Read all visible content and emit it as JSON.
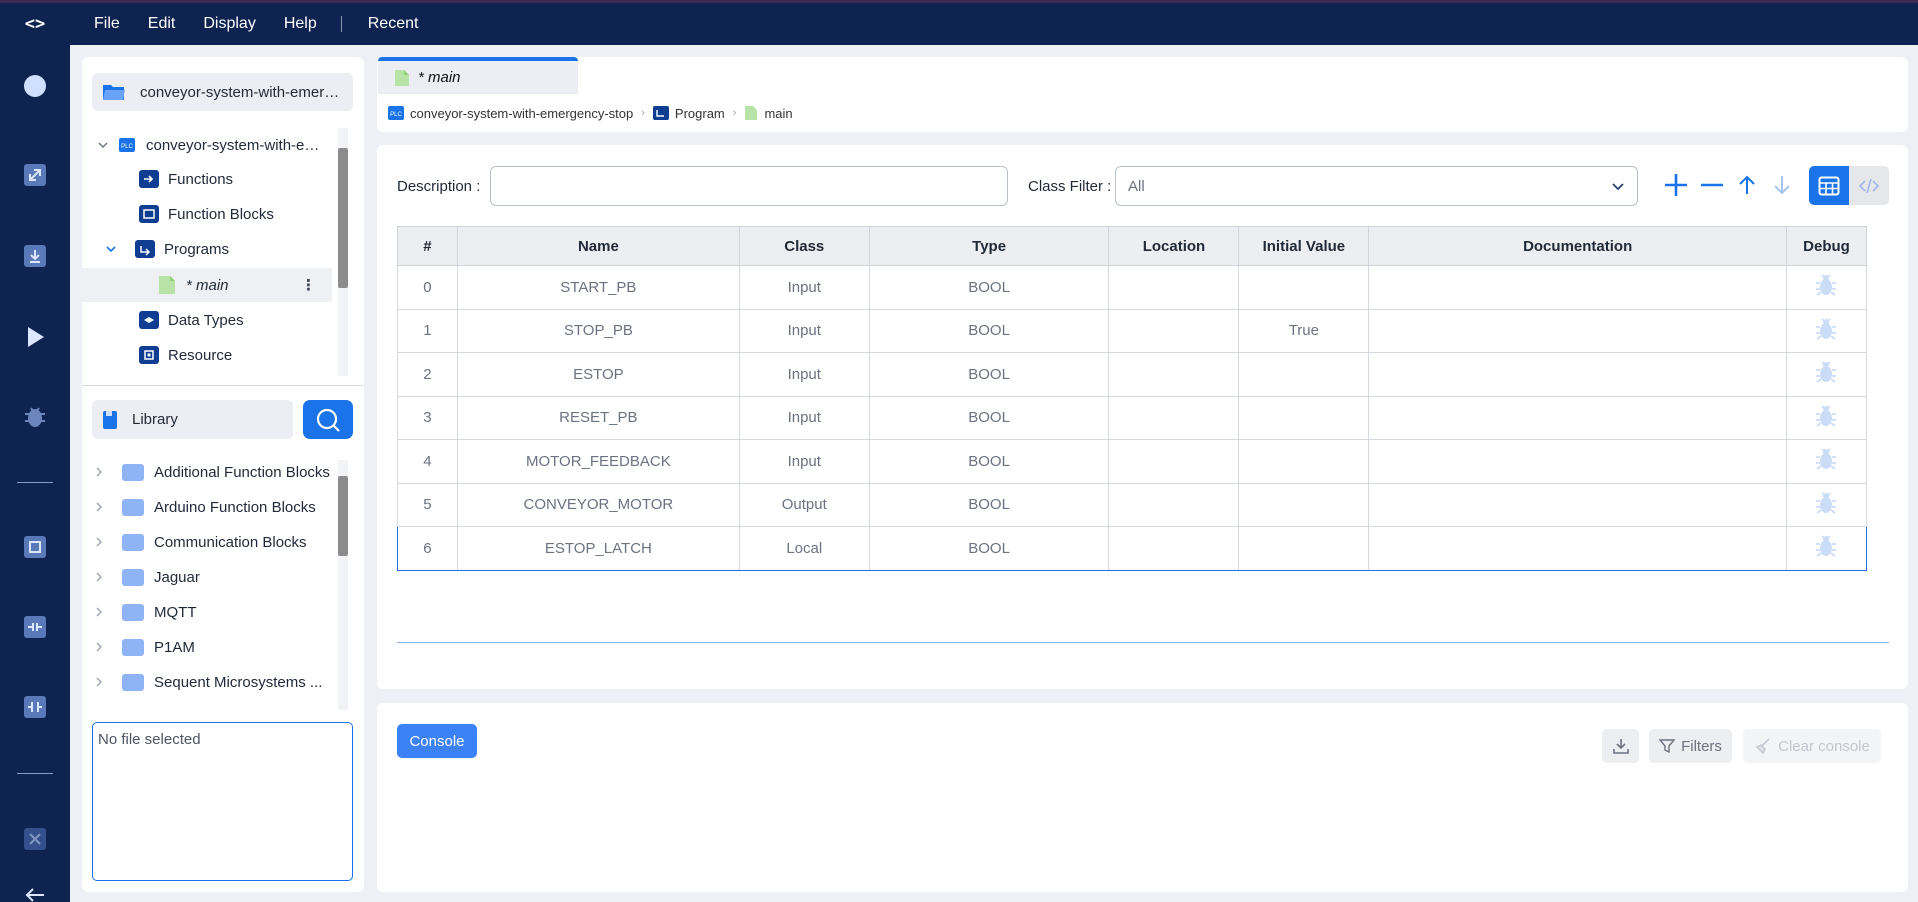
{
  "menu": {
    "logo": "<>",
    "items": [
      "File",
      "Edit",
      "Display",
      "Help"
    ],
    "recent": "Recent"
  },
  "project": {
    "header_title": "conveyor-system-with-emergency-stop",
    "tree": {
      "root_label": "conveyor-system-with-emergency-stop",
      "functions": "Functions",
      "function_blocks": "Function Blocks",
      "programs": "Programs",
      "main": "* main",
      "data_types": "Data Types",
      "resource": "Resource"
    }
  },
  "library": {
    "title": "Library",
    "items": [
      "Additional Function Blocks",
      "Arduino Function Blocks",
      "Communication Blocks",
      "Jaguar",
      "MQTT",
      "P1AM",
      "Sequent Microsystems ..."
    ]
  },
  "file_box": {
    "text": "No file selected"
  },
  "editor": {
    "tab_label": "* main",
    "breadcrumb": {
      "plc_badge": "PLC",
      "project": "conveyor-system-with-emergency-stop",
      "program": "Program",
      "pou": "main"
    },
    "description_label": "Description :",
    "description_value": "",
    "class_filter_label": "Class Filter :",
    "class_filter_value": "All",
    "columns": [
      "#",
      "Name",
      "Class",
      "Type",
      "Location",
      "Initial Value",
      "Documentation",
      "Debug"
    ],
    "rows": [
      {
        "n": "0",
        "name": "START_PB",
        "cls": "Input",
        "type": "BOOL",
        "loc": "",
        "init": "",
        "doc": ""
      },
      {
        "n": "1",
        "name": "STOP_PB",
        "cls": "Input",
        "type": "BOOL",
        "loc": "",
        "init": "True",
        "doc": ""
      },
      {
        "n": "2",
        "name": "ESTOP",
        "cls": "Input",
        "type": "BOOL",
        "loc": "",
        "init": "",
        "doc": ""
      },
      {
        "n": "3",
        "name": "RESET_PB",
        "cls": "Input",
        "type": "BOOL",
        "loc": "",
        "init": "",
        "doc": ""
      },
      {
        "n": "4",
        "name": "MOTOR_FEEDBACK",
        "cls": "Input",
        "type": "BOOL",
        "loc": "",
        "init": "",
        "doc": ""
      },
      {
        "n": "5",
        "name": "CONVEYOR_MOTOR",
        "cls": "Output",
        "type": "BOOL",
        "loc": "",
        "init": "",
        "doc": ""
      },
      {
        "n": "6",
        "name": "ESTOP_LATCH",
        "cls": "Local",
        "type": "BOOL",
        "loc": "",
        "init": "",
        "doc": ""
      }
    ]
  },
  "console": {
    "tab": "Console",
    "filters": "Filters",
    "clear": "Clear console"
  },
  "colors": {
    "sidebar": "#0f2350",
    "accent": "#1a73e8",
    "background": "#edf0f5"
  }
}
